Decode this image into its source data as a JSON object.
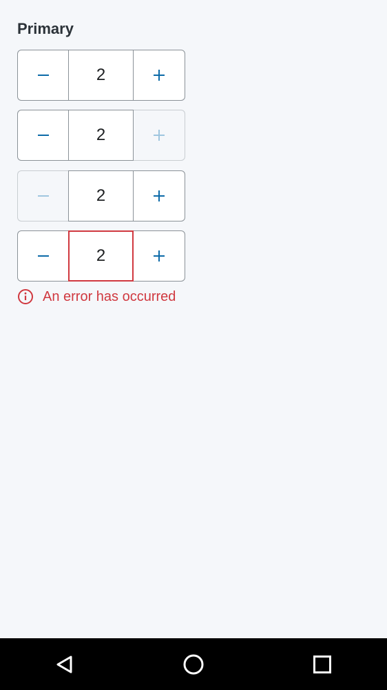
{
  "section": {
    "title": "Primary"
  },
  "steppers": [
    {
      "value": "2",
      "minus_disabled": false,
      "plus_disabled": false,
      "error": false
    },
    {
      "value": "2",
      "minus_disabled": false,
      "plus_disabled": true,
      "error": false
    },
    {
      "value": "2",
      "minus_disabled": true,
      "plus_disabled": false,
      "error": false
    },
    {
      "value": "2",
      "minus_disabled": false,
      "plus_disabled": false,
      "error": true
    }
  ],
  "error": {
    "message": "An error has occurred",
    "icon": "info-circle-icon",
    "color": "#d0383f"
  },
  "colors": {
    "accent": "#0b6aa8",
    "disabled_accent": "#9fc6df",
    "background": "#f5f7fa"
  },
  "navbar": {
    "icons": [
      "back-triangle-icon",
      "home-circle-icon",
      "recents-square-icon"
    ]
  }
}
